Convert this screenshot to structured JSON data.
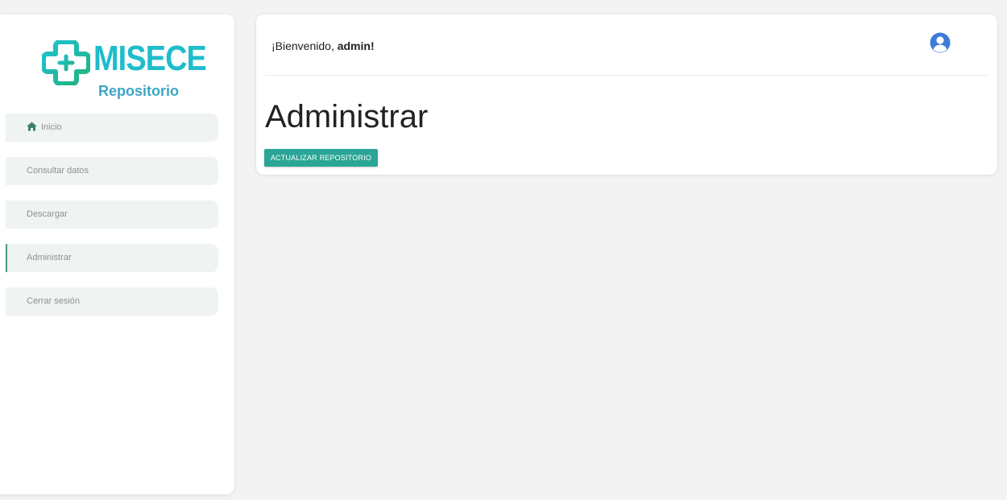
{
  "brand": {
    "name": "MISECE",
    "subtitle": "Repositorio",
    "primary_color": "#1fbdcc",
    "secondary_color": "#3aa6c6"
  },
  "sidebar": {
    "items": [
      {
        "label": "Inicio",
        "icon": "home-icon",
        "active": false
      },
      {
        "label": "Consultar datos",
        "active": false
      },
      {
        "label": "Descargar",
        "active": false
      },
      {
        "label": "Administrar",
        "active": true
      },
      {
        "label": "Cerrar sesión",
        "active": false
      }
    ],
    "active_indicator_color": "#4a9a88"
  },
  "header": {
    "welcome_prefix": "¡Bienvenido, ",
    "username": "admin!",
    "avatar_icon": "user-circle-icon",
    "avatar_color": "#3f7bd8"
  },
  "main": {
    "title": "Administrar",
    "action_button_label": "ACTUALIZAR REPOSITORIO",
    "action_button_color": "#2aa596"
  }
}
